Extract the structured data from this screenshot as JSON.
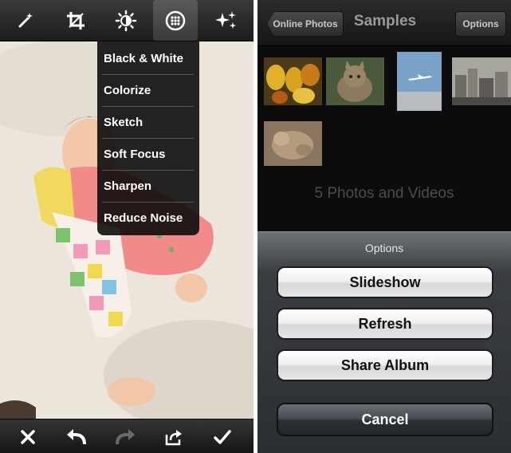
{
  "editor": {
    "toolbar_top": {
      "icons": [
        "magic-wand-icon",
        "crop-icon",
        "brightness-icon",
        "effects-icon",
        "sparkle-stars-icon"
      ],
      "active_icon": "effects-icon"
    },
    "filter_menu": {
      "items": [
        {
          "label": "Black & White"
        },
        {
          "label": "Colorize"
        },
        {
          "label": "Sketch"
        },
        {
          "label": "Soft Focus"
        },
        {
          "label": "Sharpen"
        },
        {
          "label": "Reduce Noise"
        }
      ]
    },
    "toolbar_bottom": {
      "icons": [
        "close-icon",
        "undo-icon",
        "redo-icon",
        "share-icon",
        "checkmark-icon"
      ]
    }
  },
  "album": {
    "nav": {
      "back_label": "Online Photos",
      "title": "Samples",
      "options_label": "Options"
    },
    "thumbnails": [
      {
        "subject": "fruit",
        "color": "#d9a21f"
      },
      {
        "subject": "cat",
        "color": "#8c7a5e"
      },
      {
        "subject": "airplane",
        "color": "#6c90b6"
      },
      {
        "subject": "city",
        "color": "#7d7a74"
      },
      {
        "subject": "dog",
        "color": "#b59b7d"
      }
    ],
    "count_text": "5 Photos and Videos",
    "action_sheet": {
      "title": "Options",
      "buttons": [
        {
          "label": "Slideshow"
        },
        {
          "label": "Refresh"
        },
        {
          "label": "Share Album"
        }
      ],
      "cancel_label": "Cancel"
    }
  }
}
